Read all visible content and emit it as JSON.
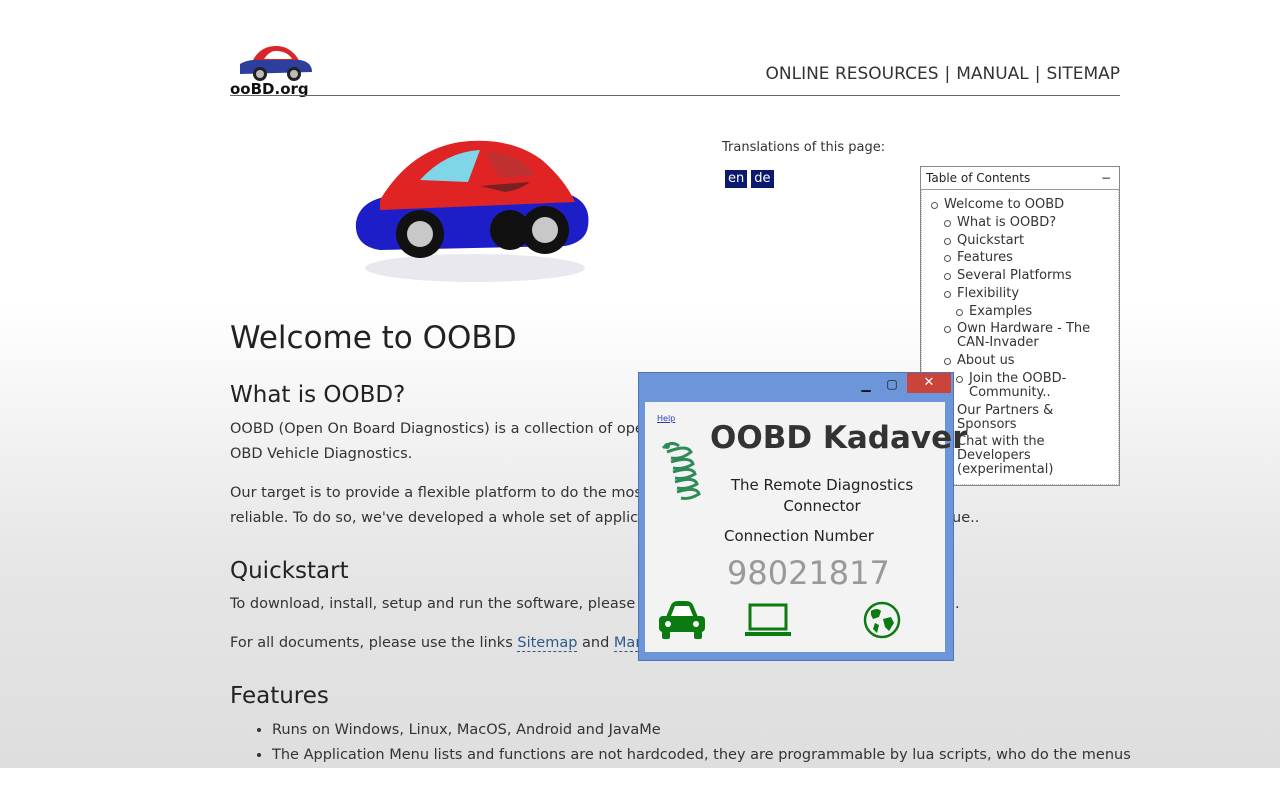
{
  "site": {
    "logo_text": "ooBD.org",
    "nav": [
      "ONLINE RESOURCES",
      "MANUAL",
      "SITEMAP"
    ],
    "nav_sep": "|"
  },
  "translations": {
    "label": "Translations of this page:",
    "languages": [
      "en",
      "de"
    ]
  },
  "toc": {
    "title": "Table of Contents",
    "toggle": "−",
    "items": [
      {
        "label": "Welcome to OOBD",
        "level": 1
      },
      {
        "label": "What is OOBD?",
        "level": 2
      },
      {
        "label": "Quickstart",
        "level": 2
      },
      {
        "label": "Features",
        "level": 2
      },
      {
        "label": "Several Platforms",
        "level": 2
      },
      {
        "label": "Flexibility",
        "level": 2
      },
      {
        "label": "Examples",
        "level": 3
      },
      {
        "label": "Own Hardware - The CAN-Invader",
        "level": 2
      },
      {
        "label": "About us",
        "level": 2
      },
      {
        "label": "Join the OOBD-Community..",
        "level": 3
      },
      {
        "label": "Our Partners & Sponsors",
        "level": 2
      },
      {
        "label": "Chat with the Developers (experimental)",
        "level": 2
      }
    ]
  },
  "content": {
    "h1": "Welcome to OOBD",
    "what_title": "What is OOBD?",
    "what_p1_line1": "OOBD (Open On Board Diagnostics) is a collection of open",
    "what_p1_line2": "OBD Vehicle Diagnostics.",
    "what_p2_line1a": "Our target is to provide a flexible platform to do the most",
    "what_p2_line1b": "",
    "what_p2_line2a": "reliable. To do so, we've developed a whole set of applicat",
    "what_p2_line2b": "ue..",
    "quick_title": "Quickstart",
    "quick_p1a": "To download, install, setup and run the software, please fo",
    "quick_p1b": ".",
    "quick_p2_prefix": "For all documents, please use the links ",
    "quick_p2_link1": "Sitemap",
    "quick_p2_mid": " and ",
    "quick_p2_link2": "Manu",
    "features_title": "Features",
    "features": [
      "Runs on Windows, Linux, MacOS, Android and JavaMe",
      "The Application Menu lists and functions are not hardcoded, they are programmable by lua scripts, who do the menus"
    ]
  },
  "popup": {
    "help": "Help",
    "minimize": "▁",
    "maximize": "▢",
    "close": "✕",
    "title": "OOBD Kadaver",
    "subtitle": "The Remote Diagnostics Connector",
    "conn_label": "Connection Number",
    "conn_number": "98021817",
    "icons": [
      "car-icon",
      "laptop-icon",
      "globe-icon"
    ],
    "icon_color": "#0b7a10"
  },
  "colors": {
    "lang_button_bg": "#0b1a6e",
    "link": "#2b5b8a",
    "window_frame": "#6c96d9",
    "close_button": "#c9453b"
  }
}
